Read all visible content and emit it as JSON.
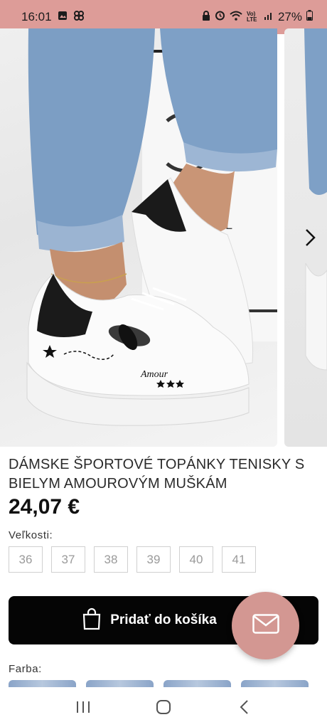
{
  "status_bar": {
    "time": "16:01",
    "battery": "27%",
    "network": "Vo) LTE",
    "icons": [
      "gallery-icon",
      "pinwheel-icon",
      "lock-icon",
      "alarm-icon",
      "wifi-icon",
      "signal-icon",
      "battery-icon"
    ]
  },
  "gallery": {
    "next_icon": "chevron-right-icon",
    "shoe_text": "Amour"
  },
  "product": {
    "title": "DÁMSKE ŠPORTOVÉ TOPÁNKY TENISKY S BIELYM AMOUROVÝM MUŠKÁM",
    "price": "24,07 €",
    "sizes_label": "Veľkosti:",
    "sizes": [
      "36",
      "37",
      "38",
      "39",
      "40",
      "41"
    ],
    "add_to_cart": "Pridať do košíka",
    "color_label": "Farba:"
  },
  "colors": {
    "status_bar_bg": "#dd9c98",
    "fab_bg": "#d39792",
    "cart_button_bg": "#050505"
  },
  "nav": {
    "icons": [
      "recent-apps-icon",
      "home-icon",
      "back-icon"
    ]
  }
}
